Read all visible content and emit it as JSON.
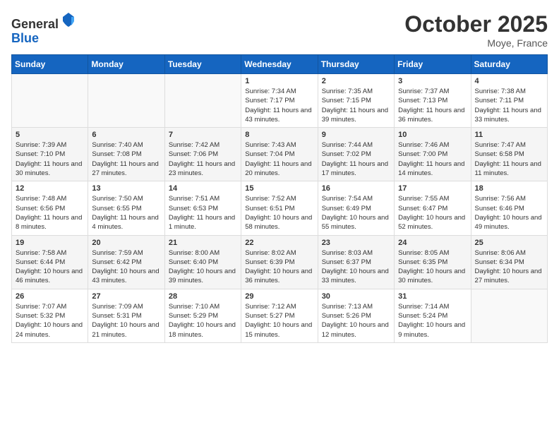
{
  "header": {
    "logo_line1": "General",
    "logo_line2": "Blue",
    "month": "October 2025",
    "location": "Moye, France"
  },
  "days_of_week": [
    "Sunday",
    "Monday",
    "Tuesday",
    "Wednesday",
    "Thursday",
    "Friday",
    "Saturday"
  ],
  "weeks": [
    [
      {
        "num": "",
        "info": ""
      },
      {
        "num": "",
        "info": ""
      },
      {
        "num": "",
        "info": ""
      },
      {
        "num": "1",
        "info": "Sunrise: 7:34 AM\nSunset: 7:17 PM\nDaylight: 11 hours and 43 minutes."
      },
      {
        "num": "2",
        "info": "Sunrise: 7:35 AM\nSunset: 7:15 PM\nDaylight: 11 hours and 39 minutes."
      },
      {
        "num": "3",
        "info": "Sunrise: 7:37 AM\nSunset: 7:13 PM\nDaylight: 11 hours and 36 minutes."
      },
      {
        "num": "4",
        "info": "Sunrise: 7:38 AM\nSunset: 7:11 PM\nDaylight: 11 hours and 33 minutes."
      }
    ],
    [
      {
        "num": "5",
        "info": "Sunrise: 7:39 AM\nSunset: 7:10 PM\nDaylight: 11 hours and 30 minutes."
      },
      {
        "num": "6",
        "info": "Sunrise: 7:40 AM\nSunset: 7:08 PM\nDaylight: 11 hours and 27 minutes."
      },
      {
        "num": "7",
        "info": "Sunrise: 7:42 AM\nSunset: 7:06 PM\nDaylight: 11 hours and 23 minutes."
      },
      {
        "num": "8",
        "info": "Sunrise: 7:43 AM\nSunset: 7:04 PM\nDaylight: 11 hours and 20 minutes."
      },
      {
        "num": "9",
        "info": "Sunrise: 7:44 AM\nSunset: 7:02 PM\nDaylight: 11 hours and 17 minutes."
      },
      {
        "num": "10",
        "info": "Sunrise: 7:46 AM\nSunset: 7:00 PM\nDaylight: 11 hours and 14 minutes."
      },
      {
        "num": "11",
        "info": "Sunrise: 7:47 AM\nSunset: 6:58 PM\nDaylight: 11 hours and 11 minutes."
      }
    ],
    [
      {
        "num": "12",
        "info": "Sunrise: 7:48 AM\nSunset: 6:56 PM\nDaylight: 11 hours and 8 minutes."
      },
      {
        "num": "13",
        "info": "Sunrise: 7:50 AM\nSunset: 6:55 PM\nDaylight: 11 hours and 4 minutes."
      },
      {
        "num": "14",
        "info": "Sunrise: 7:51 AM\nSunset: 6:53 PM\nDaylight: 11 hours and 1 minute."
      },
      {
        "num": "15",
        "info": "Sunrise: 7:52 AM\nSunset: 6:51 PM\nDaylight: 10 hours and 58 minutes."
      },
      {
        "num": "16",
        "info": "Sunrise: 7:54 AM\nSunset: 6:49 PM\nDaylight: 10 hours and 55 minutes."
      },
      {
        "num": "17",
        "info": "Sunrise: 7:55 AM\nSunset: 6:47 PM\nDaylight: 10 hours and 52 minutes."
      },
      {
        "num": "18",
        "info": "Sunrise: 7:56 AM\nSunset: 6:46 PM\nDaylight: 10 hours and 49 minutes."
      }
    ],
    [
      {
        "num": "19",
        "info": "Sunrise: 7:58 AM\nSunset: 6:44 PM\nDaylight: 10 hours and 46 minutes."
      },
      {
        "num": "20",
        "info": "Sunrise: 7:59 AM\nSunset: 6:42 PM\nDaylight: 10 hours and 43 minutes."
      },
      {
        "num": "21",
        "info": "Sunrise: 8:00 AM\nSunset: 6:40 PM\nDaylight: 10 hours and 39 minutes."
      },
      {
        "num": "22",
        "info": "Sunrise: 8:02 AM\nSunset: 6:39 PM\nDaylight: 10 hours and 36 minutes."
      },
      {
        "num": "23",
        "info": "Sunrise: 8:03 AM\nSunset: 6:37 PM\nDaylight: 10 hours and 33 minutes."
      },
      {
        "num": "24",
        "info": "Sunrise: 8:05 AM\nSunset: 6:35 PM\nDaylight: 10 hours and 30 minutes."
      },
      {
        "num": "25",
        "info": "Sunrise: 8:06 AM\nSunset: 6:34 PM\nDaylight: 10 hours and 27 minutes."
      }
    ],
    [
      {
        "num": "26",
        "info": "Sunrise: 7:07 AM\nSunset: 5:32 PM\nDaylight: 10 hours and 24 minutes."
      },
      {
        "num": "27",
        "info": "Sunrise: 7:09 AM\nSunset: 5:31 PM\nDaylight: 10 hours and 21 minutes."
      },
      {
        "num": "28",
        "info": "Sunrise: 7:10 AM\nSunset: 5:29 PM\nDaylight: 10 hours and 18 minutes."
      },
      {
        "num": "29",
        "info": "Sunrise: 7:12 AM\nSunset: 5:27 PM\nDaylight: 10 hours and 15 minutes."
      },
      {
        "num": "30",
        "info": "Sunrise: 7:13 AM\nSunset: 5:26 PM\nDaylight: 10 hours and 12 minutes."
      },
      {
        "num": "31",
        "info": "Sunrise: 7:14 AM\nSunset: 5:24 PM\nDaylight: 10 hours and 9 minutes."
      },
      {
        "num": "",
        "info": ""
      }
    ]
  ]
}
